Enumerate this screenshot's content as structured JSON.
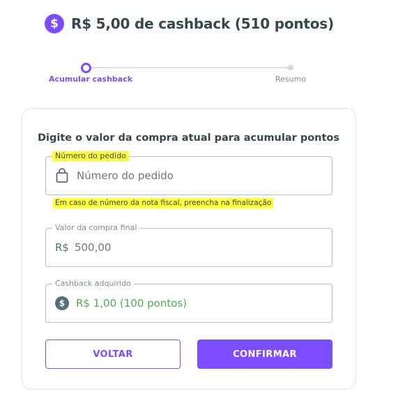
{
  "header": {
    "icon": "dollar-coin-icon",
    "icon_glyph": "$",
    "title": "R$ 5,00 de cashback (510 pontos)"
  },
  "stepper": {
    "steps": [
      {
        "label": "Acumular cashback",
        "active": true
      },
      {
        "label": "Resumo",
        "active": false
      }
    ]
  },
  "form": {
    "heading": "Digite o valor da compra atual para acumular pontos",
    "order_field": {
      "label": "Número do pedido",
      "placeholder": "Número do pedido",
      "icon": "shopping-bag-icon"
    },
    "order_helper": "Em caso de número da nota fiscal, preencha na finalização",
    "value_field": {
      "label": "Valor da compra final",
      "prefix": "R$",
      "placeholder": "500,00"
    },
    "cashback_field": {
      "label": "Cashback adquirido",
      "icon": "money-icon",
      "icon_glyph": "$",
      "value": "R$ 1,00 (100 pontos)"
    }
  },
  "actions": {
    "back_label": "VOLTAR",
    "confirm_label": "CONFIRMAR"
  },
  "colors": {
    "accent": "#7c4dff",
    "success": "#4caf50",
    "highlight": "#ffff33",
    "text": "#37474f"
  }
}
